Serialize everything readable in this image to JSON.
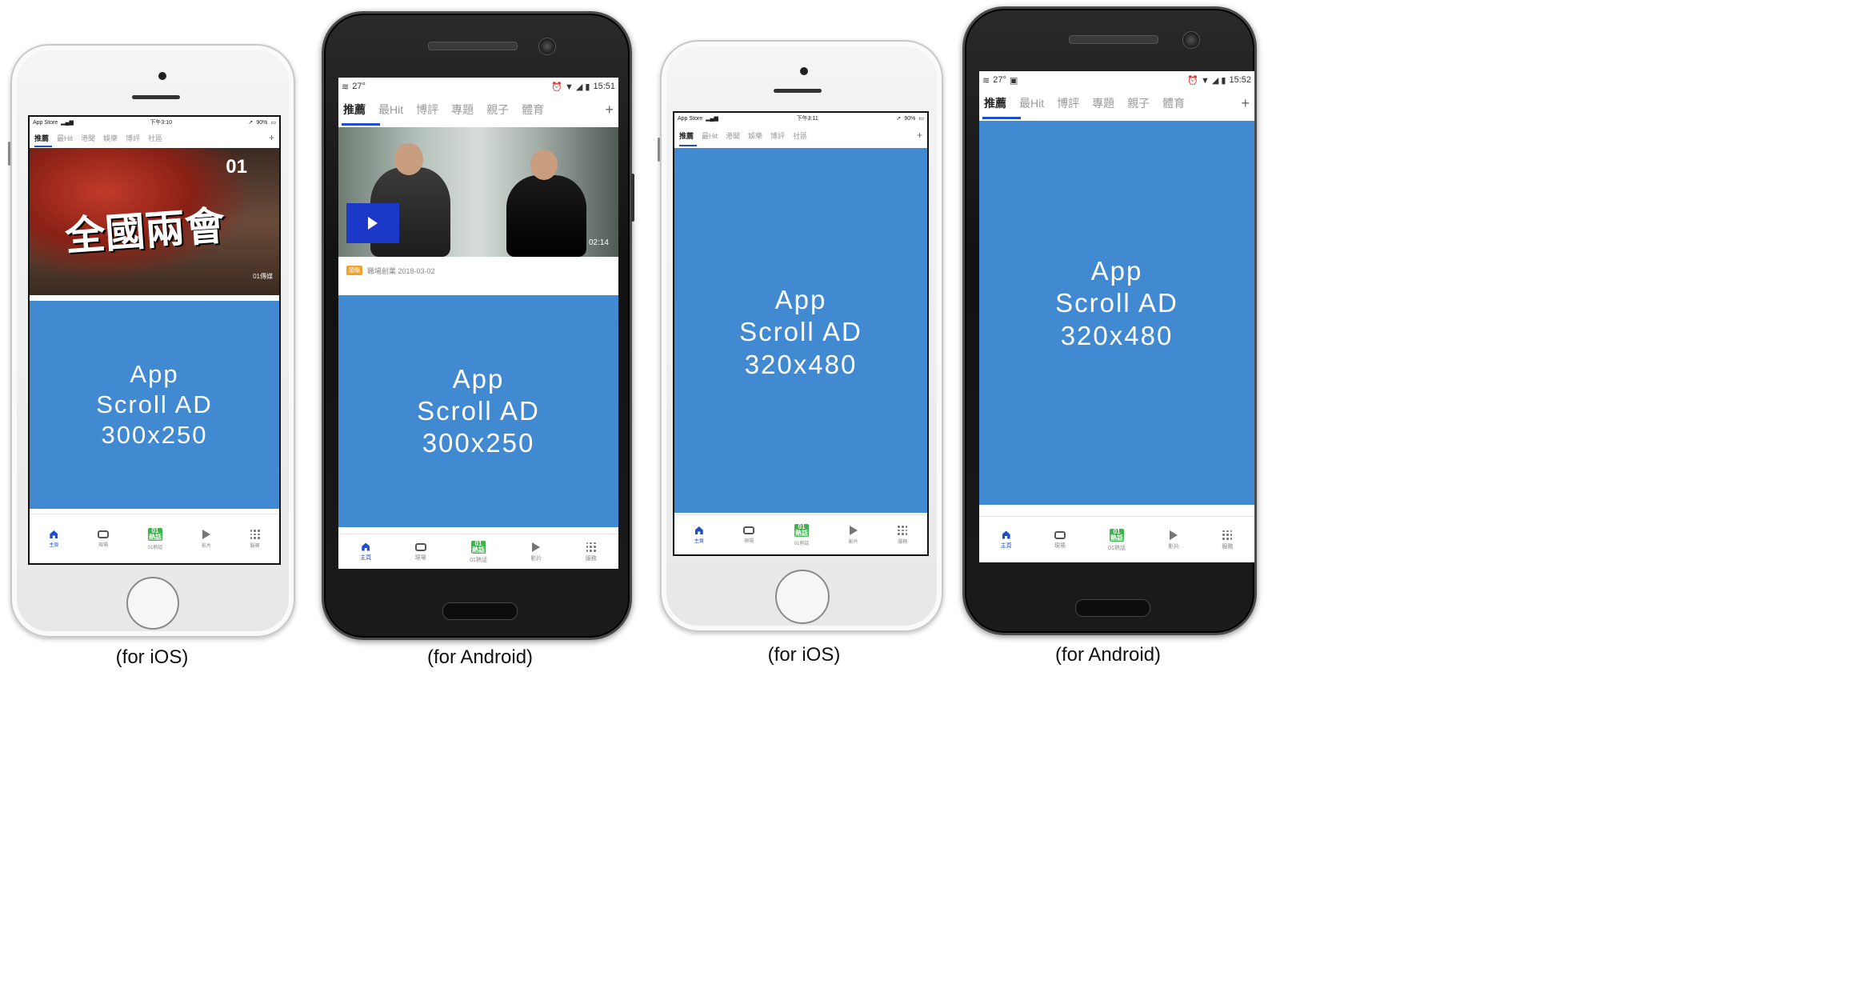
{
  "ad_color": "#4189d1",
  "accent_color": "#1e4fc6",
  "phones": [
    {
      "platform": "iOS",
      "status": {
        "left": "App Store",
        "center": "下午3:10",
        "right": "90%"
      },
      "tabs": [
        "推薦",
        "最Hit",
        "港聞",
        "娛樂",
        "博評",
        "社區"
      ],
      "plus": "+",
      "ad": {
        "line1": "App",
        "line2": "Scroll AD",
        "line3": "300x250"
      },
      "news": {
        "headline": "全國兩會",
        "brand": "01",
        "credit": "01傳媒"
      },
      "nav": [
        "主頁",
        "現場",
        "01熱話",
        "影片",
        "服務"
      ],
      "caption": "(for iOS)"
    },
    {
      "platform": "Android",
      "status": {
        "left": "27°",
        "center": "",
        "right": "15:51"
      },
      "tabs": [
        "推薦",
        "最Hit",
        "博評",
        "專題",
        "親子",
        "體育"
      ],
      "plus": "+",
      "ad": {
        "line1": "App",
        "line2": "Scroll AD",
        "line3": "300x250"
      },
      "news": {
        "duration": "02:14",
        "badge": "頭條",
        "meta": "職場創業  2018-03-02"
      },
      "nav": [
        "主頁",
        "現場",
        "01熱話",
        "影片",
        "服務"
      ],
      "caption": "(for Android)"
    },
    {
      "platform": "iOS",
      "status": {
        "left": "App Store",
        "center": "下午3:11",
        "right": "90%"
      },
      "tabs": [
        "推薦",
        "最Hit",
        "港聞",
        "娛樂",
        "博評",
        "社區"
      ],
      "plus": "+",
      "ad": {
        "line1": "App",
        "line2": "Scroll AD",
        "line3": "320x480"
      },
      "nav": [
        "主頁",
        "現場",
        "01熱話",
        "影片",
        "服務"
      ],
      "caption": "(for iOS)"
    },
    {
      "platform": "Android",
      "status": {
        "left": "27°",
        "center": "",
        "right": "15:52"
      },
      "tabs": [
        "推薦",
        "最Hit",
        "博評",
        "專題",
        "親子",
        "體育"
      ],
      "plus": "+",
      "ad": {
        "line1": "App",
        "line2": "Scroll AD",
        "line3": "320x480"
      },
      "nav": [
        "主頁",
        "現場",
        "01熱話",
        "影片",
        "服務"
      ],
      "caption": "(for Android)"
    }
  ]
}
